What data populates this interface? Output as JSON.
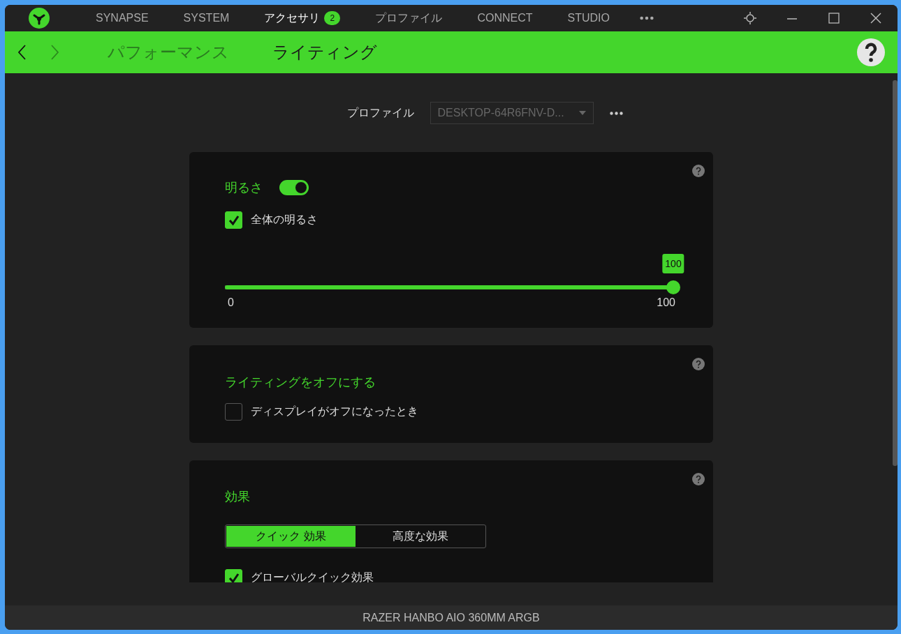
{
  "app_tabs": [
    {
      "label": "SYNAPSE",
      "selected": false
    },
    {
      "label": "SYSTEM",
      "selected": false
    },
    {
      "label": "アクセサリ",
      "selected": true,
      "badge": "2"
    },
    {
      "label": "プロファイル",
      "selected": false
    },
    {
      "label": "CONNECT",
      "selected": false
    },
    {
      "label": "STUDIO",
      "selected": false
    }
  ],
  "nav": {
    "back_disabled": false,
    "forward_disabled": true
  },
  "sub_tabs": [
    {
      "label": "パフォーマンス",
      "selected": false
    },
    {
      "label": "ライティング",
      "selected": true
    }
  ],
  "profile": {
    "label": "プロファイル",
    "value": "DESKTOP-64R6FNV-D..."
  },
  "brightness": {
    "title": "明るさ",
    "on": true,
    "checkbox": {
      "label": "全体の明るさ",
      "checked": true
    },
    "slider": {
      "level": 1,
      "value": "100",
      "min": "0",
      "max": "100"
    }
  },
  "lighting_off": {
    "title": "ライティングをオフにする",
    "checkbox": {
      "label": "ディスプレイがオフになったとき",
      "checked": false
    }
  },
  "effects": {
    "title": "効果",
    "segments": [
      {
        "label": "クイック 効果",
        "selected": true
      },
      {
        "label": "高度な効果",
        "selected": false
      }
    ],
    "checkbox": {
      "label": "グローバルクイック効果",
      "checked": true
    }
  },
  "status_bar": "RAZER HANBO AIO 360MM ARGB"
}
